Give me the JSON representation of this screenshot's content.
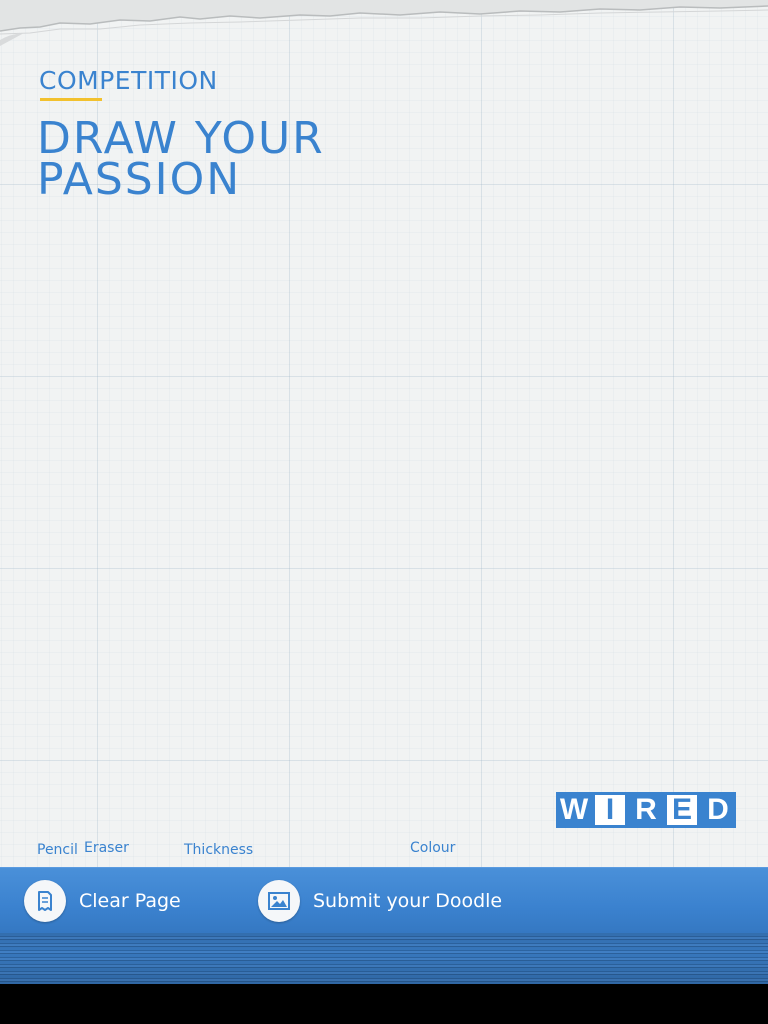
{
  "header": {
    "kicker": "COMPETITION",
    "title_line1": "DRAW YOUR",
    "title_line2": "PASSION"
  },
  "logo": {
    "letters": [
      "W",
      "I",
      "R",
      "E",
      "D"
    ]
  },
  "tools": {
    "pencil": "Pencil",
    "eraser": "Eraser",
    "thickness": "Thickness",
    "colour": "Colour"
  },
  "bottom_bar": {
    "clear_label": "Clear Page",
    "clear_icon": "clear-page-icon",
    "submit_label": "Submit your Doodle",
    "submit_icon": "image-icon"
  },
  "colors": {
    "accent_blue": "#3a83cf",
    "underline_yellow": "#f2c12e",
    "paper": "#f1f3f3"
  }
}
